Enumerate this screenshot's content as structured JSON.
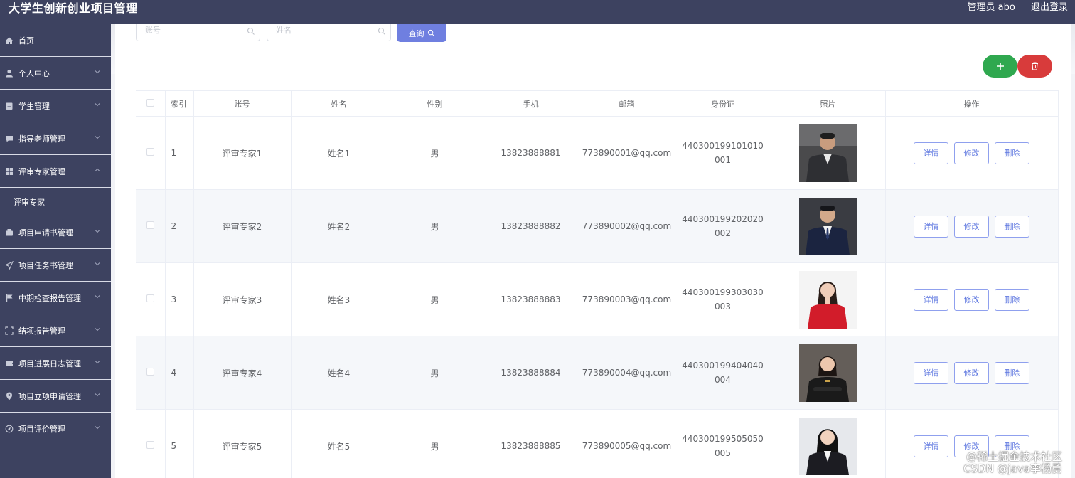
{
  "header": {
    "title": "大学生创新创业项目管理",
    "admin_label": "管理员 abo",
    "logout_label": "退出登录"
  },
  "sidebar": {
    "items": [
      {
        "label": "首页",
        "icon": "home-icon"
      },
      {
        "label": "个人中心",
        "icon": "user-icon"
      },
      {
        "label": "学生管理",
        "icon": "student-icon"
      },
      {
        "label": "指导老师管理",
        "icon": "chat-icon"
      },
      {
        "label": "评审专家管理",
        "icon": "grid-icon",
        "expanded": true
      },
      {
        "label": "项目申请书管理",
        "icon": "briefcase-icon"
      },
      {
        "label": "项目任务书管理",
        "icon": "send-icon"
      },
      {
        "label": "中期检查报告管理",
        "icon": "flag-icon"
      },
      {
        "label": "结项报告管理",
        "icon": "frame-icon"
      },
      {
        "label": "项目进展日志管理",
        "icon": "ticket-icon"
      },
      {
        "label": "项目立项申请管理",
        "icon": "location-icon"
      },
      {
        "label": "项目评价管理",
        "icon": "compass-icon"
      }
    ],
    "subitem": "评审专家"
  },
  "search": {
    "account_placeholder": "账号",
    "name_placeholder": "姓名",
    "query_label": "查询"
  },
  "table": {
    "headers": [
      "索引",
      "账号",
      "姓名",
      "性别",
      "手机",
      "邮箱",
      "身份证",
      "照片",
      "操作"
    ],
    "rows": [
      {
        "index": "1",
        "account": "评审专家1",
        "name": "姓名1",
        "gender": "男",
        "phone": "13823888881",
        "email": "773890001@qq.com",
        "idcard": "440300199101010001"
      },
      {
        "index": "2",
        "account": "评审专家2",
        "name": "姓名2",
        "gender": "男",
        "phone": "13823888882",
        "email": "773890002@qq.com",
        "idcard": "440300199202020002"
      },
      {
        "index": "3",
        "account": "评审专家3",
        "name": "姓名3",
        "gender": "男",
        "phone": "13823888883",
        "email": "773890003@qq.com",
        "idcard": "440300199303030003"
      },
      {
        "index": "4",
        "account": "评审专家4",
        "name": "姓名4",
        "gender": "男",
        "phone": "13823888884",
        "email": "773890004@qq.com",
        "idcard": "440300199404040004"
      },
      {
        "index": "5",
        "account": "评审专家5",
        "name": "姓名5",
        "gender": "男",
        "phone": "13823888885",
        "email": "773890005@qq.com",
        "idcard": "440300199505050005"
      }
    ],
    "actions": {
      "detail": "详情",
      "edit": "修改",
      "delete": "删除"
    }
  },
  "watermark": {
    "line1": "@稀土掘金技术社区",
    "line2": "CSDN @java李杨勇"
  },
  "colors": {
    "sidebar_bg": "#3d4260",
    "primary": "#6f7fe0",
    "add": "#2fa84f",
    "delete": "#d83b3b"
  }
}
